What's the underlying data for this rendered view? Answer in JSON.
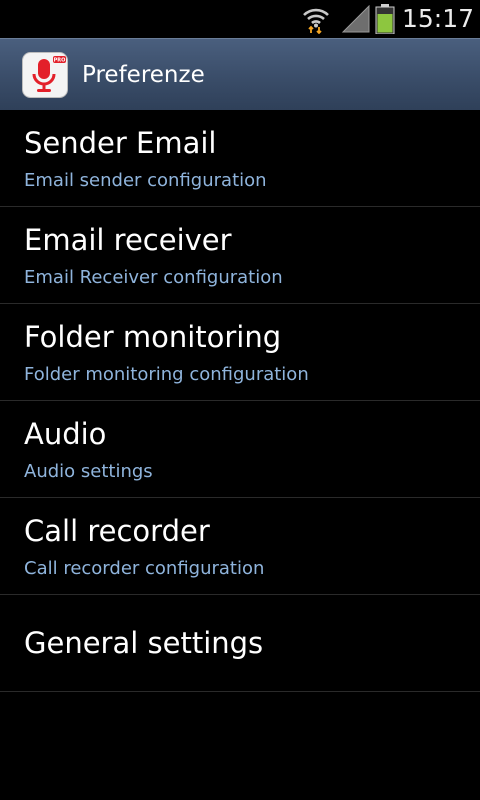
{
  "status_bar": {
    "time": "15:17",
    "icons": [
      "wifi-icon",
      "signal-icon",
      "battery-icon"
    ],
    "battery_color": "#8dc63f"
  },
  "action_bar": {
    "title": "Preferenze",
    "app_icon": "microphone-icon",
    "app_icon_badge": "PRO",
    "app_icon_color": "#e3202a"
  },
  "preferences": [
    {
      "title": "Sender Email",
      "summary": "Email sender configuration"
    },
    {
      "title": "Email receiver",
      "summary": "Email Receiver configuration"
    },
    {
      "title": "Folder monitoring",
      "summary": "Folder monitoring configuration"
    },
    {
      "title": "Audio",
      "summary": "Audio settings"
    },
    {
      "title": "Call recorder",
      "summary": "Call recorder configuration"
    },
    {
      "title": "General settings"
    }
  ],
  "colors": {
    "summary_text": "#8fb4dc",
    "action_bar": "#3a4d69",
    "divider": "#2a2a2a"
  }
}
